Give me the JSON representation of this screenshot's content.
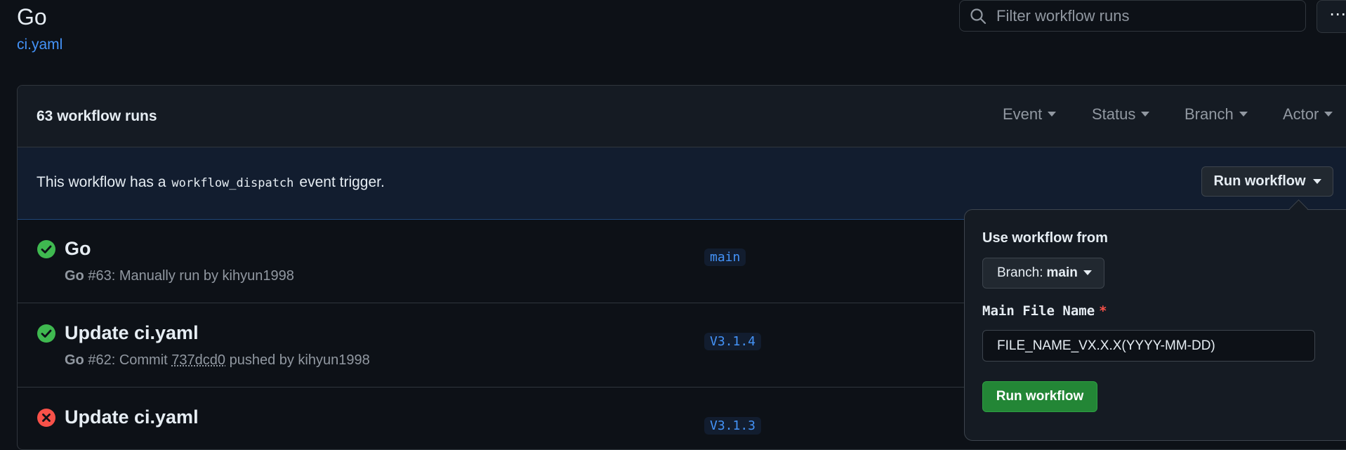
{
  "header": {
    "title": "Go",
    "file_link": "ci.yaml",
    "search_placeholder": "Filter workflow runs",
    "more_label": "⋯"
  },
  "runs": {
    "count_label": "63 workflow runs",
    "filters": [
      "Event",
      "Status",
      "Branch",
      "Actor"
    ],
    "dispatch": {
      "text_before": "This workflow has a",
      "code": "workflow_dispatch",
      "text_after": "event trigger.",
      "button_label": "Run workflow"
    },
    "rows": [
      {
        "status": "success",
        "title": "Go",
        "meta_prefix": "Go",
        "meta_text": " #63: Manually run by kihyun1998",
        "branch": "main"
      },
      {
        "status": "success",
        "title": "Update ci.yaml",
        "meta_prefix": "Go",
        "meta_text_before": " #62: Commit ",
        "commit": "737dcd0",
        "meta_text_after": " pushed by kihyun1998",
        "branch": "V3.1.4"
      },
      {
        "status": "failure",
        "title": "Update ci.yaml",
        "branch": "V3.1.3"
      }
    ]
  },
  "popover": {
    "heading": "Use workflow from",
    "branch_label": "Branch:",
    "branch_value": "main",
    "field_label": "Main File Name",
    "field_required": "*",
    "field_value": "FILE_NAME_VX.X.X(YYYY-MM-DD)",
    "submit_label": "Run workflow"
  },
  "colors": {
    "background": "#0d1117",
    "accent_blue": "#4493f8",
    "success_green": "#3fb950",
    "failure_red": "#f85149",
    "button_green": "#238636"
  }
}
